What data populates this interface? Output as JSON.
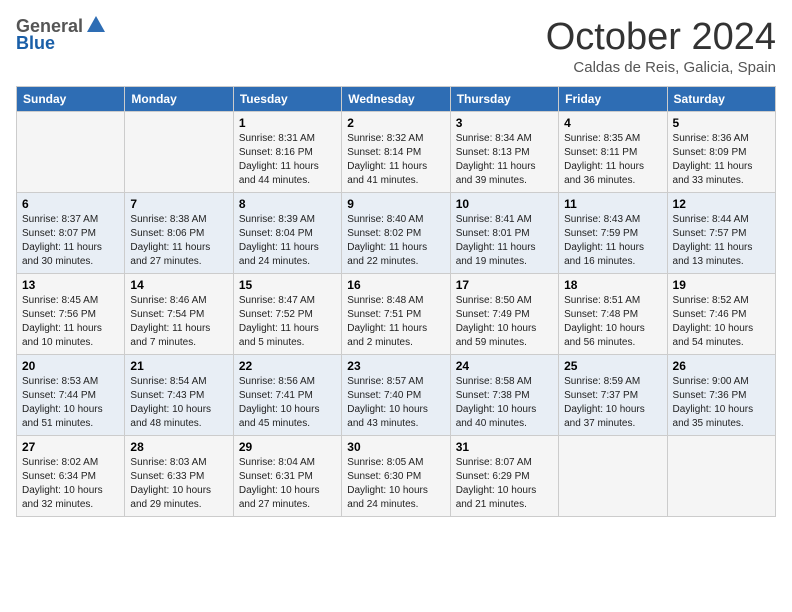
{
  "header": {
    "logo_general": "General",
    "logo_blue": "Blue",
    "month": "October 2024",
    "location": "Caldas de Reis, Galicia, Spain"
  },
  "weekdays": [
    "Sunday",
    "Monday",
    "Tuesday",
    "Wednesday",
    "Thursday",
    "Friday",
    "Saturday"
  ],
  "weeks": [
    [
      null,
      null,
      {
        "day": "1",
        "sunrise": "Sunrise: 8:31 AM",
        "sunset": "Sunset: 8:16 PM",
        "daylight": "Daylight: 11 hours and 44 minutes."
      },
      {
        "day": "2",
        "sunrise": "Sunrise: 8:32 AM",
        "sunset": "Sunset: 8:14 PM",
        "daylight": "Daylight: 11 hours and 41 minutes."
      },
      {
        "day": "3",
        "sunrise": "Sunrise: 8:34 AM",
        "sunset": "Sunset: 8:13 PM",
        "daylight": "Daylight: 11 hours and 39 minutes."
      },
      {
        "day": "4",
        "sunrise": "Sunrise: 8:35 AM",
        "sunset": "Sunset: 8:11 PM",
        "daylight": "Daylight: 11 hours and 36 minutes."
      },
      {
        "day": "5",
        "sunrise": "Sunrise: 8:36 AM",
        "sunset": "Sunset: 8:09 PM",
        "daylight": "Daylight: 11 hours and 33 minutes."
      }
    ],
    [
      {
        "day": "6",
        "sunrise": "Sunrise: 8:37 AM",
        "sunset": "Sunset: 8:07 PM",
        "daylight": "Daylight: 11 hours and 30 minutes."
      },
      {
        "day": "7",
        "sunrise": "Sunrise: 8:38 AM",
        "sunset": "Sunset: 8:06 PM",
        "daylight": "Daylight: 11 hours and 27 minutes."
      },
      {
        "day": "8",
        "sunrise": "Sunrise: 8:39 AM",
        "sunset": "Sunset: 8:04 PM",
        "daylight": "Daylight: 11 hours and 24 minutes."
      },
      {
        "day": "9",
        "sunrise": "Sunrise: 8:40 AM",
        "sunset": "Sunset: 8:02 PM",
        "daylight": "Daylight: 11 hours and 22 minutes."
      },
      {
        "day": "10",
        "sunrise": "Sunrise: 8:41 AM",
        "sunset": "Sunset: 8:01 PM",
        "daylight": "Daylight: 11 hours and 19 minutes."
      },
      {
        "day": "11",
        "sunrise": "Sunrise: 8:43 AM",
        "sunset": "Sunset: 7:59 PM",
        "daylight": "Daylight: 11 hours and 16 minutes."
      },
      {
        "day": "12",
        "sunrise": "Sunrise: 8:44 AM",
        "sunset": "Sunset: 7:57 PM",
        "daylight": "Daylight: 11 hours and 13 minutes."
      }
    ],
    [
      {
        "day": "13",
        "sunrise": "Sunrise: 8:45 AM",
        "sunset": "Sunset: 7:56 PM",
        "daylight": "Daylight: 11 hours and 10 minutes."
      },
      {
        "day": "14",
        "sunrise": "Sunrise: 8:46 AM",
        "sunset": "Sunset: 7:54 PM",
        "daylight": "Daylight: 11 hours and 7 minutes."
      },
      {
        "day": "15",
        "sunrise": "Sunrise: 8:47 AM",
        "sunset": "Sunset: 7:52 PM",
        "daylight": "Daylight: 11 hours and 5 minutes."
      },
      {
        "day": "16",
        "sunrise": "Sunrise: 8:48 AM",
        "sunset": "Sunset: 7:51 PM",
        "daylight": "Daylight: 11 hours and 2 minutes."
      },
      {
        "day": "17",
        "sunrise": "Sunrise: 8:50 AM",
        "sunset": "Sunset: 7:49 PM",
        "daylight": "Daylight: 10 hours and 59 minutes."
      },
      {
        "day": "18",
        "sunrise": "Sunrise: 8:51 AM",
        "sunset": "Sunset: 7:48 PM",
        "daylight": "Daylight: 10 hours and 56 minutes."
      },
      {
        "day": "19",
        "sunrise": "Sunrise: 8:52 AM",
        "sunset": "Sunset: 7:46 PM",
        "daylight": "Daylight: 10 hours and 54 minutes."
      }
    ],
    [
      {
        "day": "20",
        "sunrise": "Sunrise: 8:53 AM",
        "sunset": "Sunset: 7:44 PM",
        "daylight": "Daylight: 10 hours and 51 minutes."
      },
      {
        "day": "21",
        "sunrise": "Sunrise: 8:54 AM",
        "sunset": "Sunset: 7:43 PM",
        "daylight": "Daylight: 10 hours and 48 minutes."
      },
      {
        "day": "22",
        "sunrise": "Sunrise: 8:56 AM",
        "sunset": "Sunset: 7:41 PM",
        "daylight": "Daylight: 10 hours and 45 minutes."
      },
      {
        "day": "23",
        "sunrise": "Sunrise: 8:57 AM",
        "sunset": "Sunset: 7:40 PM",
        "daylight": "Daylight: 10 hours and 43 minutes."
      },
      {
        "day": "24",
        "sunrise": "Sunrise: 8:58 AM",
        "sunset": "Sunset: 7:38 PM",
        "daylight": "Daylight: 10 hours and 40 minutes."
      },
      {
        "day": "25",
        "sunrise": "Sunrise: 8:59 AM",
        "sunset": "Sunset: 7:37 PM",
        "daylight": "Daylight: 10 hours and 37 minutes."
      },
      {
        "day": "26",
        "sunrise": "Sunrise: 9:00 AM",
        "sunset": "Sunset: 7:36 PM",
        "daylight": "Daylight: 10 hours and 35 minutes."
      }
    ],
    [
      {
        "day": "27",
        "sunrise": "Sunrise: 8:02 AM",
        "sunset": "Sunset: 6:34 PM",
        "daylight": "Daylight: 10 hours and 32 minutes."
      },
      {
        "day": "28",
        "sunrise": "Sunrise: 8:03 AM",
        "sunset": "Sunset: 6:33 PM",
        "daylight": "Daylight: 10 hours and 29 minutes."
      },
      {
        "day": "29",
        "sunrise": "Sunrise: 8:04 AM",
        "sunset": "Sunset: 6:31 PM",
        "daylight": "Daylight: 10 hours and 27 minutes."
      },
      {
        "day": "30",
        "sunrise": "Sunrise: 8:05 AM",
        "sunset": "Sunset: 6:30 PM",
        "daylight": "Daylight: 10 hours and 24 minutes."
      },
      {
        "day": "31",
        "sunrise": "Sunrise: 8:07 AM",
        "sunset": "Sunset: 6:29 PM",
        "daylight": "Daylight: 10 hours and 21 minutes."
      },
      null,
      null
    ]
  ]
}
